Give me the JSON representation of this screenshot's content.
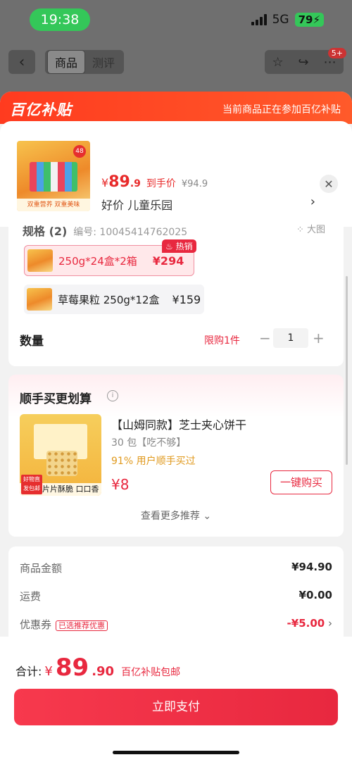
{
  "status_bar": {
    "time": "19:38",
    "network": "5G",
    "battery": "79"
  },
  "nav": {
    "back_icon": "chevron-left-icon",
    "tabs": [
      {
        "label": "商品",
        "active": true
      },
      {
        "label": "测评",
        "active": false
      }
    ],
    "actions": [
      "star-icon",
      "share-icon",
      "more-icon"
    ],
    "badge": "5+"
  },
  "sheet": {
    "brand": "百亿补贴",
    "notice": "当前商品正在参加百亿补贴",
    "product": {
      "thumb_strip": "双重营养 双重美味",
      "thumb_badge": "48",
      "price_currency": "¥",
      "price_int": "89",
      "price_dec": ".9",
      "price_label": "到手价",
      "original_price": "¥94.9",
      "subtitle": "好价  儿童乐园"
    },
    "spec": {
      "title": "规格 (2)",
      "code_label": "编号:",
      "code": "10045414762025",
      "big_img_label": "大图",
      "options": [
        {
          "label": "250g*24盒*2箱",
          "price": "¥294",
          "selected": true,
          "tag": "热销"
        },
        {
          "label": "草莓果粒 250g*12盒",
          "price": "¥159",
          "selected": false
        }
      ],
      "quantity_label": "数量",
      "limit": "限购1件",
      "quantity": "1"
    },
    "recommend": {
      "title": "顺手买更划算",
      "item_name": "【山姆同款】芝士夹心饼干",
      "item_sub": "30 包【吃不够】",
      "item_stat": "91% 用户顺手买过",
      "item_price": "¥8",
      "img_label": "片片酥脆 口口香浓",
      "img_badge": "好物直发包邮",
      "buy_label": "一键购买",
      "more_label": "查看更多推荐"
    },
    "summary": {
      "rows": [
        {
          "label": "商品金额",
          "value": "¥94.90"
        },
        {
          "label": "运费",
          "value": "¥0.00"
        },
        {
          "label": "优惠券",
          "tag": "已选推荐优惠",
          "value": "-¥5.00"
        }
      ]
    },
    "footer": {
      "total_label": "合计:",
      "currency": "¥",
      "total_int": "89",
      "total_dec": ".90",
      "total_tag": "百亿补贴包邮",
      "pay_label": "立即支付"
    }
  },
  "colors": {
    "accent": "#e8283f",
    "brand": "#ff3b1f",
    "battery": "#34c759"
  }
}
